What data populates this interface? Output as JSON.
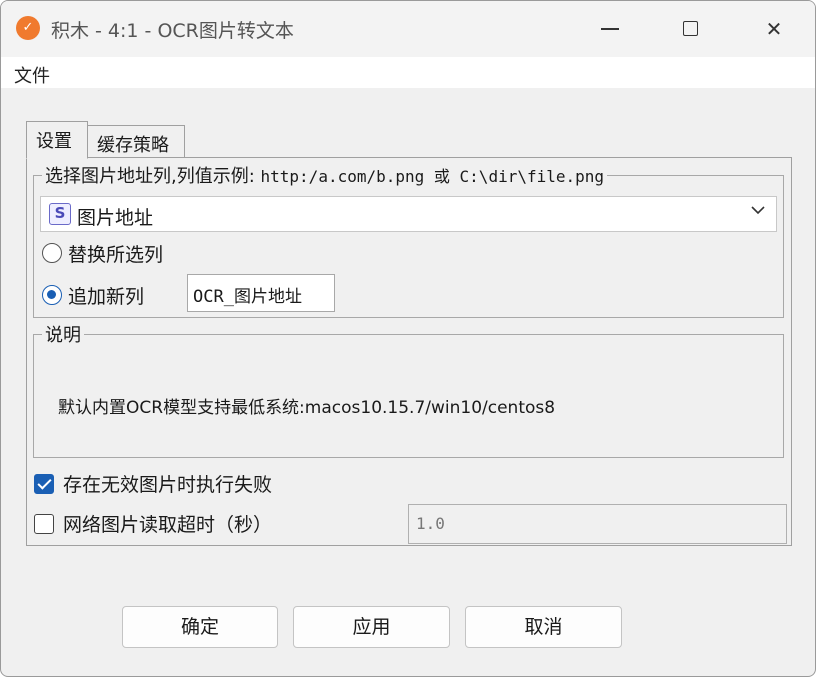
{
  "window": {
    "title": "积木 - 4:1 - OCR图片转文本",
    "app_icon": "logo-icon",
    "controls": [
      "minimize-icon",
      "maximize-icon",
      "close-icon"
    ]
  },
  "menu": {
    "file": "文件"
  },
  "tabs": [
    {
      "label": "设置",
      "active": true
    },
    {
      "label": "缓存策略",
      "active": false
    }
  ],
  "column_group": {
    "title_prefix": "选择图片地址列,列值示例: ",
    "title_example": "http:/a.com/b.png 或 C:\\dir\\file.png",
    "select_badge": "S",
    "selected_column": "图片地址",
    "options": [
      {
        "label": "替换所选列",
        "checked": false
      },
      {
        "label": "追加新列",
        "checked": true
      }
    ],
    "new_column_value": "OCR_图片地址"
  },
  "info_group": {
    "title": "说明",
    "text": "默认内置OCR模型支持最低系统:macos10.15.7/win10/centos8"
  },
  "fail_on_invalid": {
    "label": "存在无效图片时执行失败",
    "checked": true
  },
  "timeout": {
    "label": "网络图片读取超时（秒）",
    "checked": false,
    "value": "1.0"
  },
  "buttons": {
    "ok": "确定",
    "apply": "应用",
    "cancel": "取消"
  },
  "colors": {
    "accent": "#1a5fb4",
    "app_icon": "#f07a2e"
  }
}
